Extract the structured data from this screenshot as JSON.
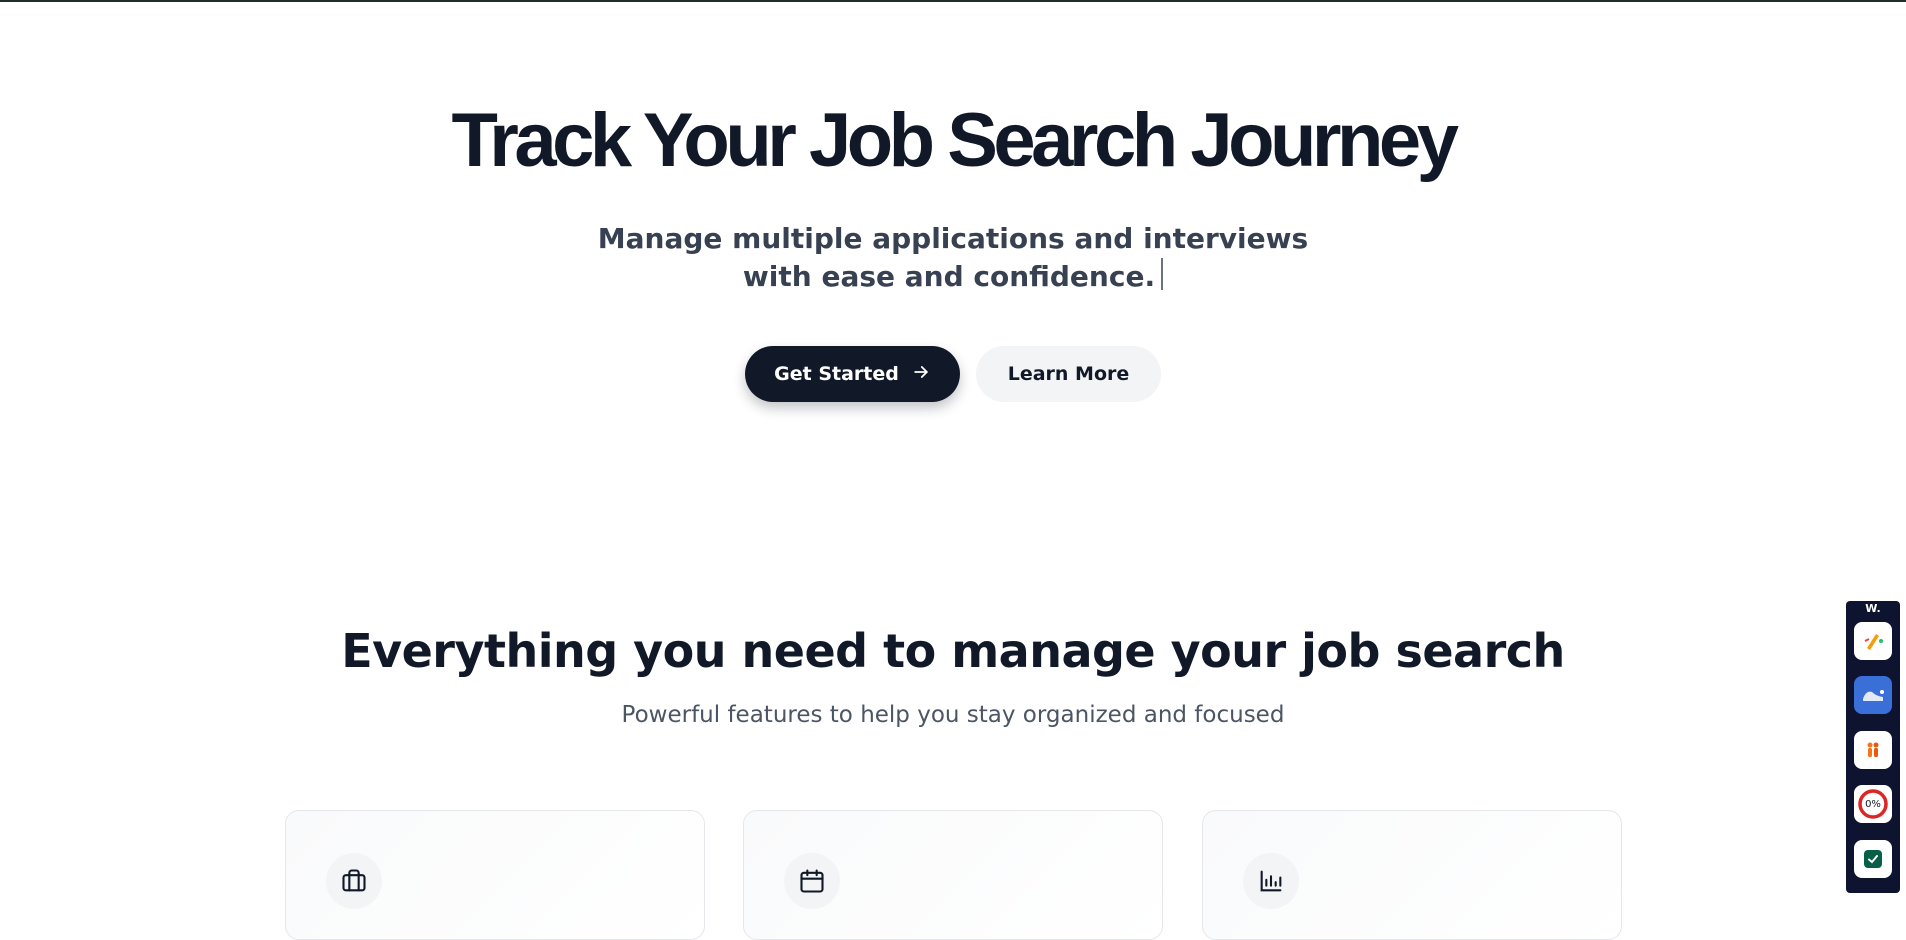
{
  "hero": {
    "title": "Track Your Job Search Journey",
    "subtitle": "Manage multiple applications and interviews with ease and confidence.",
    "get_started_label": "Get Started",
    "learn_more_label": "Learn More"
  },
  "features": {
    "title": "Everything you need to manage your job search",
    "subtitle": "Powerful features to help you stay organized and focused",
    "cards": [
      {
        "icon": "briefcase-icon"
      },
      {
        "icon": "calendar-icon"
      },
      {
        "icon": "bar-chart-icon"
      }
    ]
  },
  "extension_panel": {
    "label": "W.",
    "buttons": [
      {
        "icon": "pen-spark-icon"
      },
      {
        "icon": "blue-shoe-icon"
      },
      {
        "icon": "people-icon"
      },
      {
        "icon": "percent-ring-icon",
        "text": "0%"
      },
      {
        "icon": "green-check-icon"
      }
    ]
  },
  "colors": {
    "primary": "#111827",
    "secondary_bg": "#f3f4f6",
    "text_muted": "#4b5563"
  }
}
